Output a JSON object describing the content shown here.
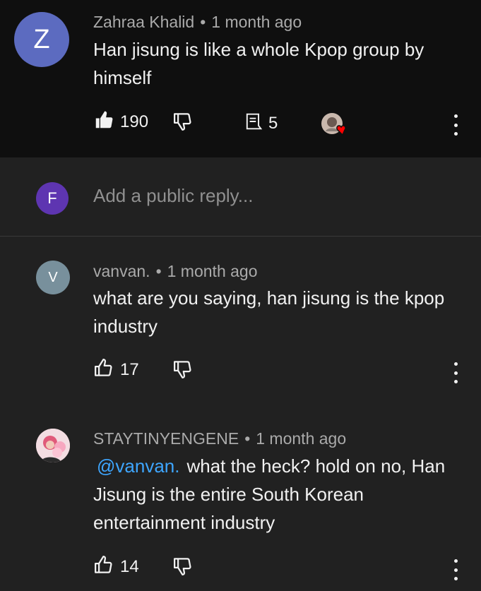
{
  "top_comment": {
    "avatar_letter": "Z",
    "avatar_color": "#5c6bc0",
    "author": "Zahraa Khalid",
    "time": "1 month ago",
    "text": "Han jisung is like a whole Kpop group by himself",
    "likes": "190",
    "replies": "5",
    "liked": true,
    "creator_heart": true,
    "like_icon": "thumbs-up-filled-icon",
    "dislike_icon": "thumbs-down-icon",
    "reply_icon": "comment-icon"
  },
  "reply_box": {
    "avatar_letter": "F",
    "avatar_color": "#5e35b1",
    "placeholder": "Add a public reply..."
  },
  "replies": [
    {
      "avatar_letter": "V",
      "avatar_color": "#78909c",
      "author": "vanvan.",
      "time": "1 month ago",
      "mention": "",
      "text": "what are you saying, han jisung is the kpop industry",
      "likes": "17"
    },
    {
      "avatar_letter": "",
      "avatar_color": "#e8c4cc",
      "author": "STAYTINYENGENE",
      "time": "1 month ago",
      "mention": "@vanvan.",
      "text": "what the heck? hold on no, Han Jisung is the entire South Korean entertainment industry",
      "likes": "14"
    }
  ],
  "icons": {
    "more": "more-vert-icon",
    "heart_color": "#ff0000"
  }
}
